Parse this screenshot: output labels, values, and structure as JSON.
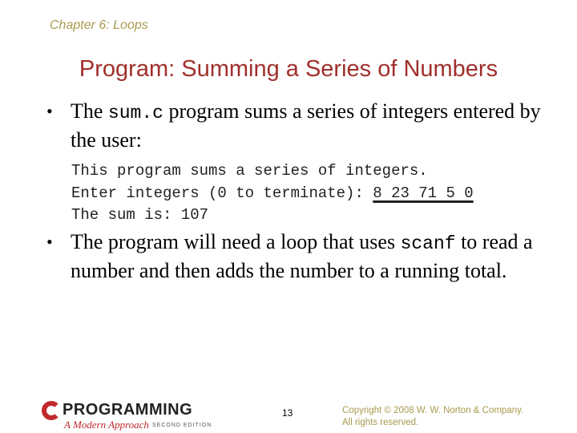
{
  "header": {
    "chapter": "Chapter 6: Loops"
  },
  "slide": {
    "title": "Program: Summing a Series of Numbers",
    "bullet1": {
      "pre": "The ",
      "code": "sum.c",
      "post": " program sums a series of integers entered by the user:"
    },
    "console": {
      "line1": "This program sums a series of integers.",
      "line2_prompt": "Enter integers (0 to terminate): ",
      "line2_input": "8 23 71 5 0",
      "line3": "The sum is: 107"
    },
    "bullet2": {
      "pre": "The program will need a loop that uses ",
      "code": "scanf",
      "post": " to read a number and then adds the number to a running total."
    }
  },
  "footer": {
    "logo": {
      "letter": "",
      "word": "PROGRAMMING",
      "subtitle": "A Modern Approach",
      "edition": "SECOND EDITION"
    },
    "page_number": "13",
    "copyright_line1": "Copyright © 2008 W. W. Norton & Company.",
    "copyright_line2": "All rights reserved."
  }
}
